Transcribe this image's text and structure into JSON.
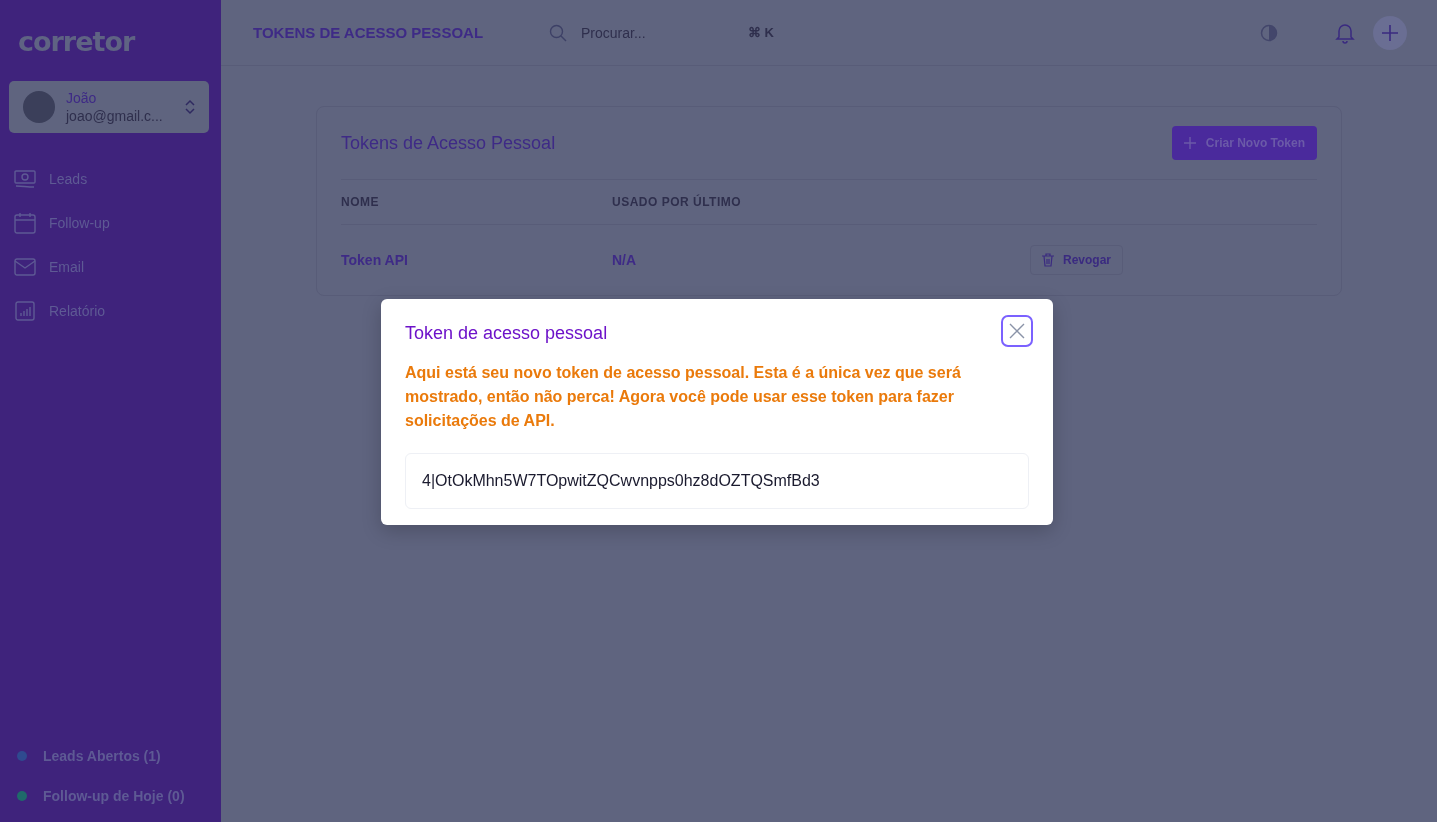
{
  "sidebar": {
    "logo": "corretor",
    "user": {
      "name": "João",
      "email": "joao@gmail.c..."
    },
    "items": [
      {
        "label": "Leads"
      },
      {
        "label": "Follow-up"
      },
      {
        "label": "Email"
      },
      {
        "label": "Relatório"
      }
    ],
    "counters": [
      {
        "label": "Leads Abertos (1)",
        "color": "#2f4a8f"
      },
      {
        "label": "Follow-up de Hoje (0)",
        "color": "#1f6a6a"
      }
    ]
  },
  "header": {
    "title": "TOKENS DE ACESSO PESSOAL",
    "search": {
      "placeholder": "Procurar..."
    },
    "shortcut": "⌘ K"
  },
  "card": {
    "title": "Tokens de Acesso Pessoal",
    "create_button": "Criar Novo Token",
    "columns": [
      "NOME",
      "USADO POR ÚLTIMO"
    ],
    "rows": [
      {
        "name": "Token API",
        "last_used": "N/A",
        "action": "Revogar"
      }
    ]
  },
  "modal": {
    "title": "Token de acesso pessoal",
    "message": "Aqui está seu novo token de acesso pessoal. Esta é a única vez que será mostrado, então não perca! Agora você pode usar esse token para fazer solicitações de API.",
    "token": "4|OtOkMhn5W7TOpwitZQCwvnpps0hz8dOZTQSmfBd3"
  }
}
